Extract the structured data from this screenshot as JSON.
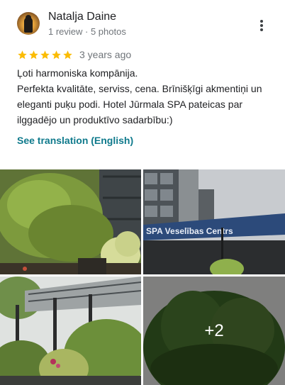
{
  "review": {
    "author_name": "Natalja Daine",
    "author_meta": "1 review · 5 photos",
    "rating": 5,
    "time": "3 years ago",
    "text_lines": [
      "Ļoti harmoniska kompānija.",
      "Perfekta kvalitāte, serviss, cena. Brīnišķīgi akmentiņi un eleganti puķu podi. Hotel Jūrmala SPA pateicas par ilggadējo un produktīvo sadarbību:)"
    ],
    "translate_label": "See translation (English)"
  },
  "photos": {
    "sign_text": "SPA Veselības Centrs",
    "more_count": "+2"
  },
  "colors": {
    "star": "#fbbc04",
    "link": "#0f7a8c",
    "secondary_text": "#70757a"
  },
  "icons": {
    "more": "more-vert-icon",
    "star": "star-icon"
  }
}
